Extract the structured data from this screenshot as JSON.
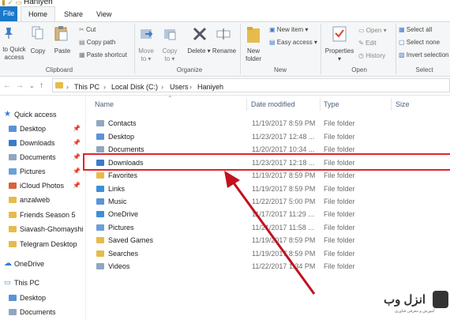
{
  "window": {
    "title": "Haniyeh"
  },
  "ribbon_tabs": [
    "File",
    "Home",
    "Share",
    "View"
  ],
  "ribbon": {
    "clipboard": {
      "pin_label_1": "to Quick",
      "pin_label_2": "access",
      "copy": "Copy",
      "paste": "Paste",
      "cut": "Cut",
      "copy_path": "Copy path",
      "paste_shortcut": "Paste shortcut",
      "group": "Clipboard"
    },
    "organize": {
      "move_to_1": "Move",
      "move_to_2": "to",
      "copy_to_1": "Copy",
      "copy_to_2": "to",
      "delete": "Delete",
      "rename": "Rename",
      "group": "Organize"
    },
    "new": {
      "new_folder_1": "New",
      "new_folder_2": "folder",
      "new_item": "New item",
      "easy_access": "Easy access",
      "group": "New"
    },
    "open": {
      "properties": "Properties",
      "open": "Open",
      "edit": "Edit",
      "history": "History",
      "group": "Open"
    },
    "select": {
      "select_all": "Select all",
      "select_none": "Select none",
      "invert_selection": "Invert selection",
      "group": "Select"
    }
  },
  "breadcrumb": [
    "This PC",
    "Local Disk (C:)",
    "Users",
    "Haniyeh"
  ],
  "nav": {
    "quick_access": "Quick access",
    "items": [
      "Desktop",
      "Downloads",
      "Documents",
      "Pictures",
      "iCloud Photos",
      "anzalweb",
      "Friends Season 5",
      "Siavash-Ghomayshi",
      "Telegram Desktop"
    ],
    "onedrive": "OneDrive",
    "this_pc": "This PC",
    "pc_items": [
      "Desktop",
      "Documents"
    ]
  },
  "columns": {
    "name": "Name",
    "date": "Date modified",
    "type": "Type",
    "size": "Size"
  },
  "rows": [
    {
      "name": "Contacts",
      "date": "11/19/2017 8:59 PM",
      "type": "File folder"
    },
    {
      "name": "Desktop",
      "date": "11/23/2017 12:48 ...",
      "type": "File folder"
    },
    {
      "name": "Documents",
      "date": "11/20/2017 10:34 ...",
      "type": "File folder"
    },
    {
      "name": "Downloads",
      "date": "11/23/2017 12:18 ...",
      "type": "File folder"
    },
    {
      "name": "Favorites",
      "date": "11/19/2017 8:59 PM",
      "type": "File folder"
    },
    {
      "name": "Links",
      "date": "11/19/2017 8:59 PM",
      "type": "File folder"
    },
    {
      "name": "Music",
      "date": "11/22/2017 5:00 PM",
      "type": "File folder"
    },
    {
      "name": "OneDrive",
      "date": "11/17/2017 11:29 ...",
      "type": "File folder"
    },
    {
      "name": "Pictures",
      "date": "11/21/2017 11:58 ...",
      "type": "File folder"
    },
    {
      "name": "Saved Games",
      "date": "11/19/2017 8:59 PM",
      "type": "File folder"
    },
    {
      "name": "Searches",
      "date": "11/19/2017 8:59 PM",
      "type": "File folder"
    },
    {
      "name": "Videos",
      "date": "11/22/2017 1:34 PM",
      "type": "File folder"
    }
  ],
  "watermark": {
    "text": "انزل وب",
    "sub": "آموزش و معرفی فناوری"
  },
  "colors": {
    "accent": "#1979ca",
    "highlight": "#e0242a",
    "arrow": "#c1121f",
    "folder": "#e7bb4b"
  }
}
